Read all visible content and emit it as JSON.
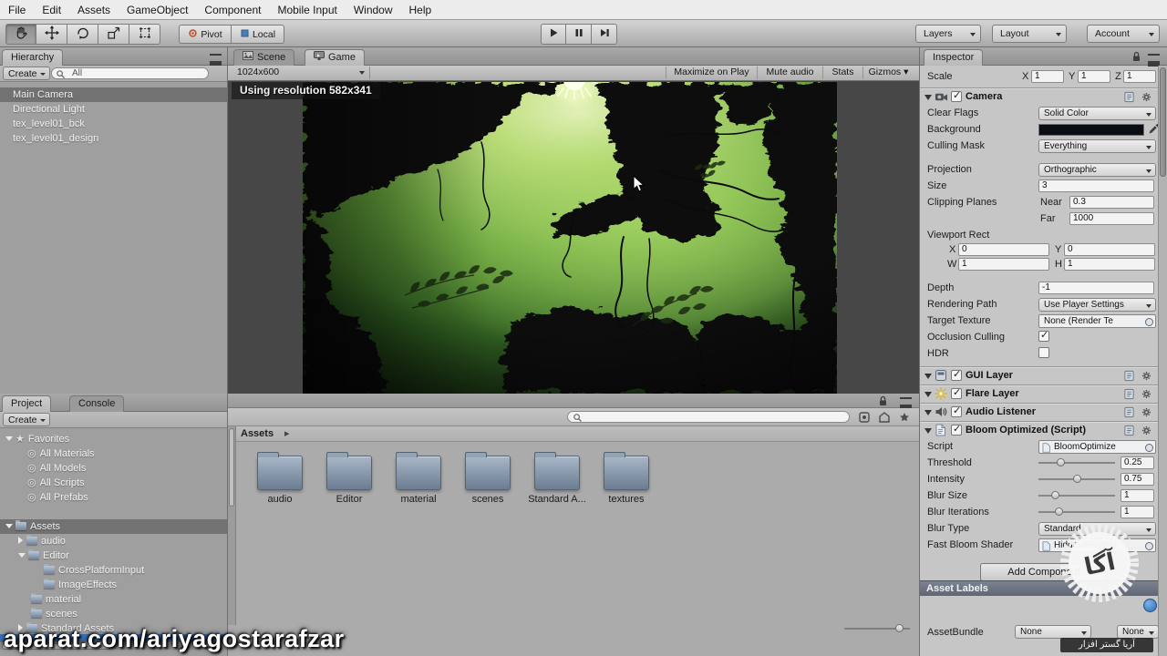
{
  "menubar": {
    "items": [
      "File",
      "Edit",
      "Assets",
      "GameObject",
      "Component",
      "Mobile Input",
      "Window",
      "Help"
    ]
  },
  "toolbar": {
    "pivot": "Pivot",
    "local": "Local",
    "layers": "Layers",
    "layout": "Layout",
    "account": "Account"
  },
  "hierarchy": {
    "tab": "Hierarchy",
    "create": "Create",
    "search": "All",
    "items": [
      {
        "label": "Main Camera"
      },
      {
        "label": "Directional Light"
      },
      {
        "label": "tex_level01_bck"
      },
      {
        "label": "tex_level01_design"
      }
    ]
  },
  "viewport": {
    "scene_tab": "Scene",
    "game_tab": "Game",
    "aspect": "1024x600",
    "maximize": "Maximize on Play",
    "mute": "Mute audio",
    "stats": "Stats",
    "gizmos": "Gizmos",
    "overlay": "Using resolution 582x341"
  },
  "project": {
    "tab": "Project",
    "console_tab": "Console",
    "create": "Create",
    "favorites_label": "Favorites",
    "favorites": [
      "All Materials",
      "All Models",
      "All Scripts",
      "All Prefabs"
    ],
    "tree": [
      {
        "label": "Assets"
      },
      {
        "label": "audio"
      },
      {
        "label": "Editor"
      },
      {
        "label": "CrossPlatformInput"
      },
      {
        "label": "ImageEffects"
      },
      {
        "label": "material"
      },
      {
        "label": "scenes"
      },
      {
        "label": "Standard Assets"
      }
    ],
    "breadcrumb": "Assets",
    "folders": [
      "audio",
      "Editor",
      "material",
      "scenes",
      "Standard A...",
      "textures"
    ]
  },
  "inspector": {
    "tab": "Inspector",
    "scale_label": "Scale",
    "x_label": "X",
    "y_label": "Y",
    "z_label": "Z",
    "scale_x": "1",
    "scale_y": "1",
    "scale_z": "1",
    "camera": {
      "title": "Camera",
      "clear_flags_label": "Clear Flags",
      "clear_flags": "Solid Color",
      "background_label": "Background",
      "culling_mask_label": "Culling Mask",
      "culling_mask": "Everything",
      "projection_label": "Projection",
      "projection": "Orthographic",
      "size_label": "Size",
      "size": "3",
      "clipping_label": "Clipping Planes",
      "near_label": "Near",
      "near": "0.3",
      "far_label": "Far",
      "far": "1000",
      "viewport_label": "Viewport Rect",
      "vx": "0",
      "vy": "0",
      "vw": "1",
      "vh": "1",
      "w_label": "W",
      "h_label": "H",
      "depth_label": "Depth",
      "depth": "-1",
      "rendering_label": "Rendering Path",
      "rendering": "Use Player Settings",
      "target_label": "Target Texture",
      "target": "None (Render Te",
      "occlusion_label": "Occlusion Culling",
      "hdr_label": "HDR"
    },
    "gui_layer": "GUI Layer",
    "flare_layer": "Flare Layer",
    "audio_listener": "Audio Listener",
    "bloom": {
      "title": "Bloom Optimized (Script)",
      "script_label": "Script",
      "script": "BloomOptimize",
      "threshold_label": "Threshold",
      "threshold": "0.25",
      "intensity_label": "Intensity",
      "intensity": "0.75",
      "blur_size_label": "Blur Size",
      "blur_size": "1",
      "blur_iter_label": "Blur Iterations",
      "blur_iter": "1",
      "blur_type_label": "Blur Type",
      "blur_type": "Standard",
      "shader_label": "Fast Bloom Shader",
      "shader": "Hidden/FastBlo"
    },
    "add_component": "Add Component",
    "asset_labels": "Asset Labels",
    "assetbundle_label": "AssetBundle",
    "bundle1": "None",
    "bundle2": "None"
  },
  "watermark": {
    "url": "aparat.com/ariyagostarafzar",
    "badge": "آریا گستر افزار"
  }
}
